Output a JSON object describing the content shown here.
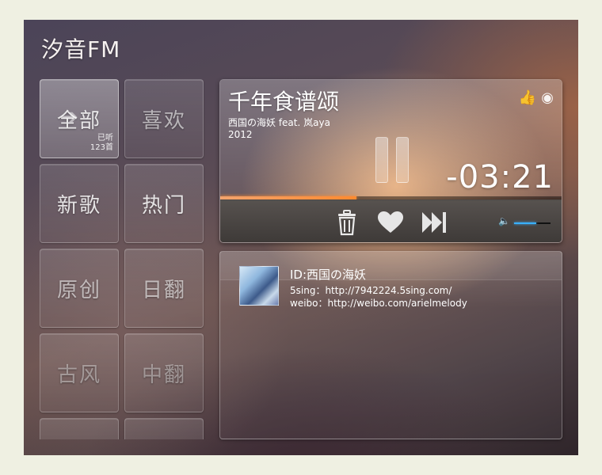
{
  "app": {
    "title": "汐音FM"
  },
  "categories": [
    {
      "label": "全部",
      "sub1": "已听",
      "sub2": "123首"
    },
    {
      "label": "喜欢"
    },
    {
      "label": "新歌"
    },
    {
      "label": "热门"
    },
    {
      "label": "原创"
    },
    {
      "label": "日翻"
    },
    {
      "label": "古风"
    },
    {
      "label": "中翻"
    },
    {
      "label": ""
    },
    {
      "label": ""
    }
  ],
  "player": {
    "title": "千年食谱颂",
    "artist": "西国の海妖 feat. 岚aya",
    "year": "2012",
    "time": "-03:21",
    "progress_fraction": 0.4,
    "volume_fraction": 0.6,
    "icons": {
      "like": "thumbs-up-icon",
      "share": "weibo-icon",
      "pause": "pause-icon",
      "trash": "trash-icon",
      "heart": "heart-icon",
      "next": "skip-next-icon",
      "volume": "volume-icon"
    }
  },
  "info": {
    "id_line": "ID:西国の海妖",
    "site_line": "5sing：http://7942224.5sing.com/",
    "weibo_line": "weibo：http://weibo.com/arielmelody"
  },
  "colors": {
    "progress": "#ff8a2f",
    "volume": "#3ab0ff"
  }
}
